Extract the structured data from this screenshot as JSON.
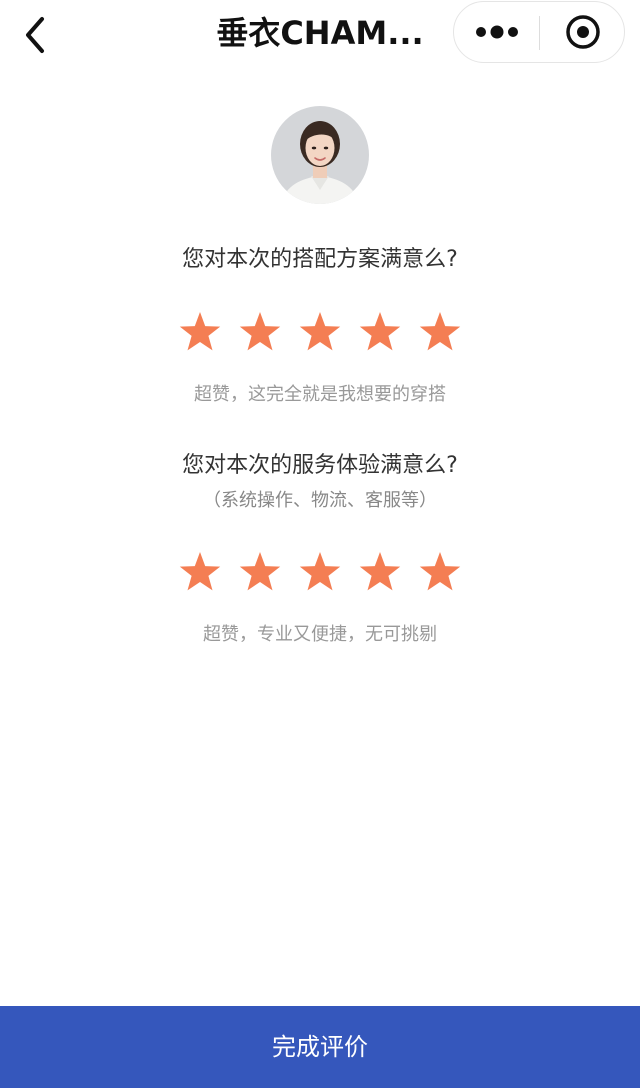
{
  "header": {
    "title": "垂衣CHAM...",
    "back_icon": "chevron-left-icon",
    "more_icon": "more-dots-icon",
    "close_icon": "target-circle-icon"
  },
  "stylist": {
    "avatar_icon": "stylist-avatar"
  },
  "outfit_rating": {
    "question": "您对本次的搭配方案满意么?",
    "stars_filled": 5,
    "stars_total": 5,
    "caption": "超赞，这完全就是我想要的穿搭"
  },
  "service_rating": {
    "question": "您对本次的服务体验满意么?",
    "note": "（系统操作、物流、客服等）",
    "stars_filled": 5,
    "stars_total": 5,
    "caption": "超赞，专业又便捷，无可挑剔"
  },
  "submit": {
    "label": "完成评价"
  },
  "colors": {
    "star": "#f47e53",
    "button": "#3557bc"
  }
}
